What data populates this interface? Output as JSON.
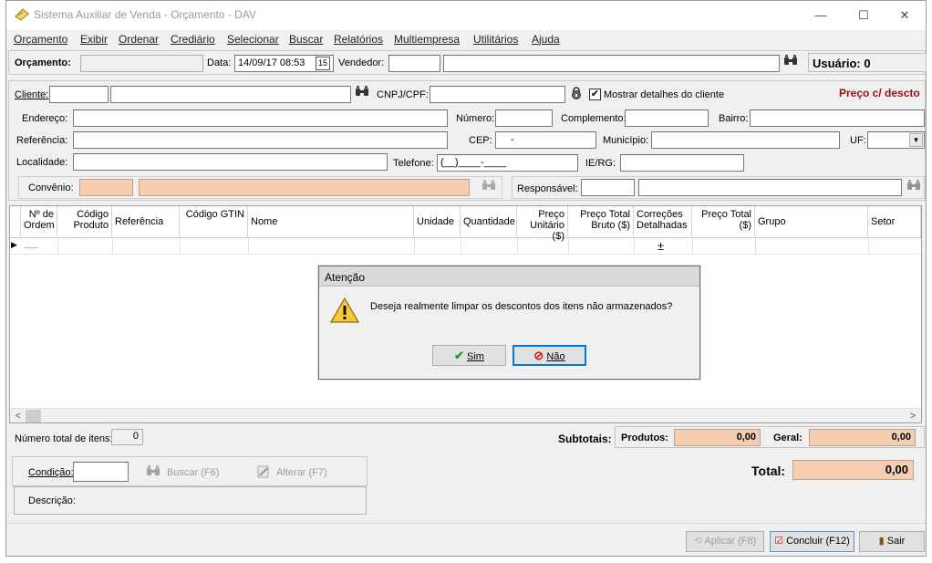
{
  "window": {
    "title": "Sistema Auxiliar de Venda - Orçamento - DAV",
    "minimize": "—",
    "maximize": "☐",
    "close": "✕"
  },
  "menu": [
    "Orçamento",
    "Exibir",
    "Ordenar",
    "Crediário",
    "Selecionar",
    "Buscar",
    "Relatórios",
    "Multiempresa",
    "Utilitários",
    "Ajuda"
  ],
  "header": {
    "orcamento_label": "Orçamento:",
    "data_label": "Data:",
    "data_value": "14/09/17 08:53",
    "calendar_glyph": "15",
    "vendedor_label": "Vendedor:",
    "usuario_label": "Usuário: 0"
  },
  "client": {
    "cliente_label": "Cliente:",
    "cnpj_label": "CNPJ/CPF:",
    "mostrar_label": "Mostrar detalhes do cliente",
    "preco_label": "Preço c/ descto",
    "endereco_label": "Endereço:",
    "numero_label": "Número:",
    "complemento_label": "Complemento:",
    "bairro_label": "Bairro:",
    "referencia_label": "Referência:",
    "cep_label": "CEP:",
    "cep_value": "-",
    "municipio_label": "Município:",
    "uf_label": "UF:",
    "localidade_label": "Localidade:",
    "telefone_label": "Telefone:",
    "telefone_value": "(__)____-____",
    "ierg_label": "IE/RG:",
    "convenio_label": "Convênio:",
    "responsavel_label": "Responsável:"
  },
  "grid": {
    "columns": [
      "Nº de Ordem",
      "Código Produto",
      "Referência",
      "Código GTIN",
      "Nome",
      "Unidade",
      "Quantidade",
      "Preço Unitário ($)",
      "Preço Total Bruto ($)",
      "Correções Detalhadas",
      "Preço Total ($)",
      "Grupo",
      "Setor"
    ],
    "row_indicator": "▶",
    "row_order_value": "___",
    "row_correction_symbol": "±",
    "scroll_left": "<",
    "scroll_right": ">"
  },
  "footer": {
    "numero_itens_label": "Número total de itens:",
    "numero_itens_value": "0",
    "subtotais_label": "Subtotais:",
    "produtos_label": "Produtos:",
    "produtos_value": "0,00",
    "geral_label": "Geral:",
    "geral_value": "0,00",
    "condicao_label": "Condição:",
    "buscar_label": "Buscar (F6)",
    "alterar_label": "Alterar (F7)",
    "descricao_label": "Descrição:",
    "total_label": "Total:",
    "total_value": "0,00",
    "aplicar_label": "Aplicar (F8)",
    "concluir_label": "Concluir (F12)",
    "sair_label": "Sair"
  },
  "dialog": {
    "title": "Atenção",
    "message": "Deseja realmente limpar os descontos dos itens não armazenados?",
    "sim_label": "Sim",
    "nao_label": "Não"
  },
  "colors": {
    "peach": "#f5cdb0",
    "preco_red": "#9b1010",
    "window_bg": "#f0f0f0"
  }
}
